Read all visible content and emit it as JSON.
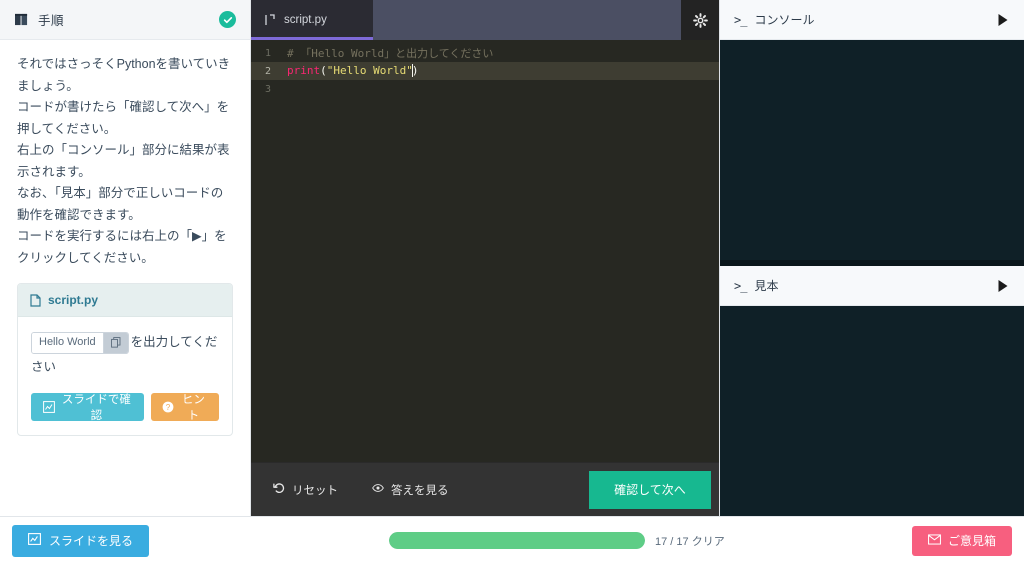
{
  "left_panel": {
    "header_title": "手順",
    "book_icon": "book-icon",
    "status_icon": "check-circle-icon",
    "instructions": [
      "それではさっそくPythonを書いていきましょう。",
      "コードが書けたら「確認して次へ」を押してください。",
      "右上の「コンソール」部分に結果が表示されます。",
      "なお、「見本」部分で正しいコードの動作を確認できます。",
      "コードを実行するには右上の「▶」をクリックしてください。"
    ],
    "task_card": {
      "filename": "script.py",
      "file_icon": "file-icon",
      "copy_value": "Hello World",
      "copy_icon": "copy-icon",
      "instruction_suffix": "を出力してください",
      "slide_button": "スライドで確認",
      "slide_icon": "chart-icon",
      "hint_button": "ヒント",
      "hint_icon": "question-icon"
    }
  },
  "editor": {
    "tab_label": "script.py",
    "tab_icon": "code-file-icon",
    "settings_icon": "gear-icon",
    "lines": [
      {
        "number": "1",
        "type": "comment",
        "text": "# 「Hello World」と出力してください"
      },
      {
        "number": "2",
        "type": "code",
        "fn": "print",
        "open": "(",
        "string": "\"Hello World\"",
        "close": ")"
      },
      {
        "number": "3",
        "type": "empty",
        "text": ""
      }
    ],
    "footer": {
      "reset_label": "リセット",
      "reset_icon": "undo-icon",
      "answer_label": "答えを見る",
      "answer_icon": "eye-icon",
      "next_button": "確認して次へ"
    },
    "accent_tab_color": "#7e6ad8",
    "next_button_color": "#17b890"
  },
  "right_panels": [
    {
      "prompt_icon": ">_",
      "title": "コンソール",
      "play_icon": "play-icon",
      "output": ""
    },
    {
      "prompt_icon": ">_",
      "title": "見本",
      "play_icon": "play-icon",
      "output": ""
    }
  ],
  "bottom_bar": {
    "view_slide_label": "スライドを見る",
    "view_slide_icon": "slide-icon",
    "view_slide_color": "#3aace0",
    "progress_percent": 100,
    "progress_label": "17 / 17 クリア",
    "progress_color": "#5ecd86",
    "feedback_label": "ご意見箱",
    "feedback_icon": "mail-icon",
    "feedback_color": "#f75f7f"
  }
}
